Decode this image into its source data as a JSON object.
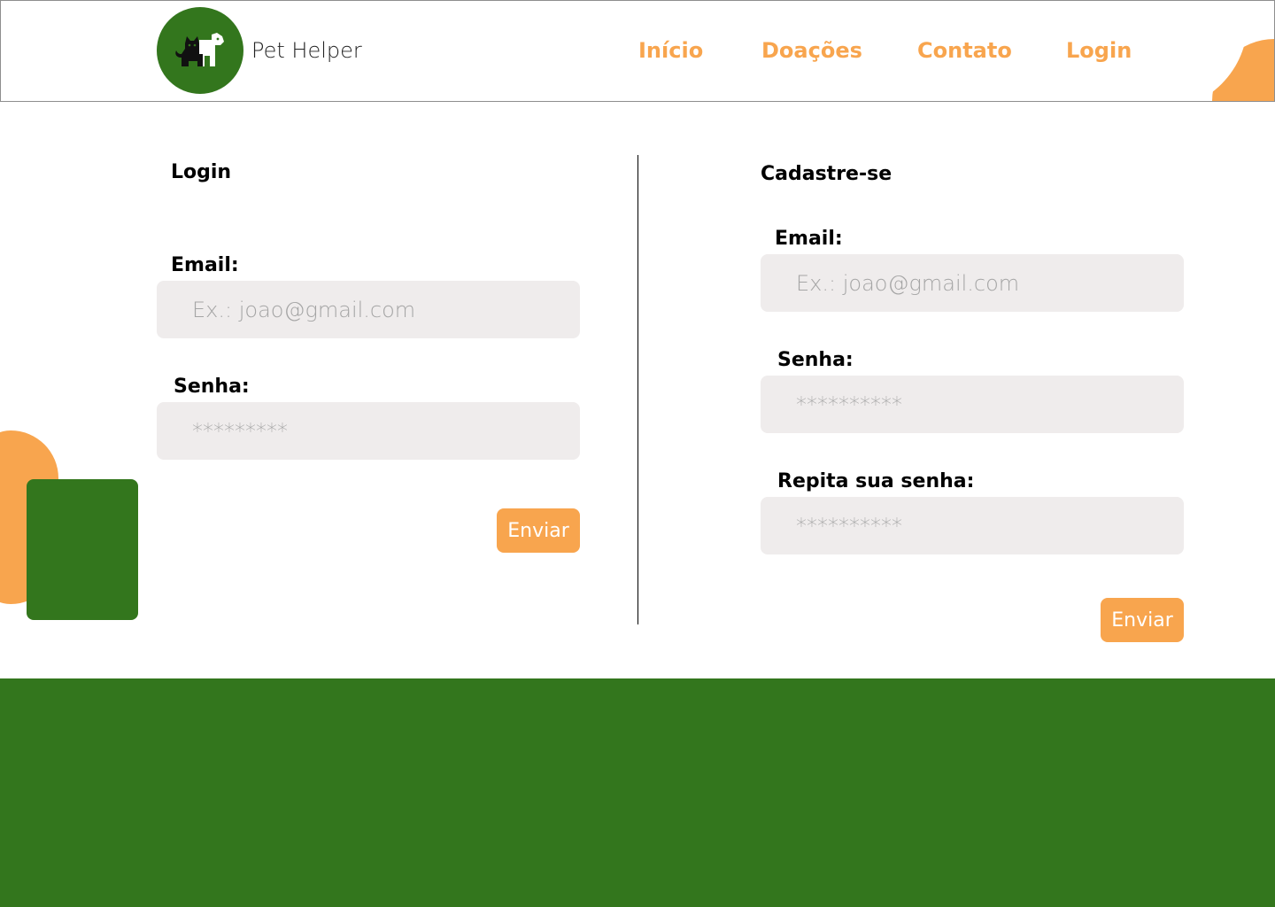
{
  "header": {
    "brand": "Pet Helper",
    "logo_icon": "cat-dog-icon",
    "nav": [
      {
        "label": "Início"
      },
      {
        "label": "Doações"
      },
      {
        "label": "Contato"
      },
      {
        "label": "Login"
      }
    ]
  },
  "login": {
    "title": "Login",
    "email_label": "Email:",
    "email_placeholder": "Ex.: joao@gmail.com",
    "password_label": "Senha:",
    "password_placeholder": "*********",
    "submit_label": "Enviar"
  },
  "register": {
    "title": "Cadastre-se",
    "email_label": "Email:",
    "email_placeholder": "Ex.: joao@gmail.com",
    "password_label": "Senha:",
    "password_placeholder": "**********",
    "repeat_label": "Repita sua senha:",
    "repeat_placeholder": "**********",
    "submit_label": "Enviar"
  },
  "colors": {
    "brand_green": "#33761d",
    "accent_orange": "#f8a54e",
    "input_bg": "#efecec"
  }
}
